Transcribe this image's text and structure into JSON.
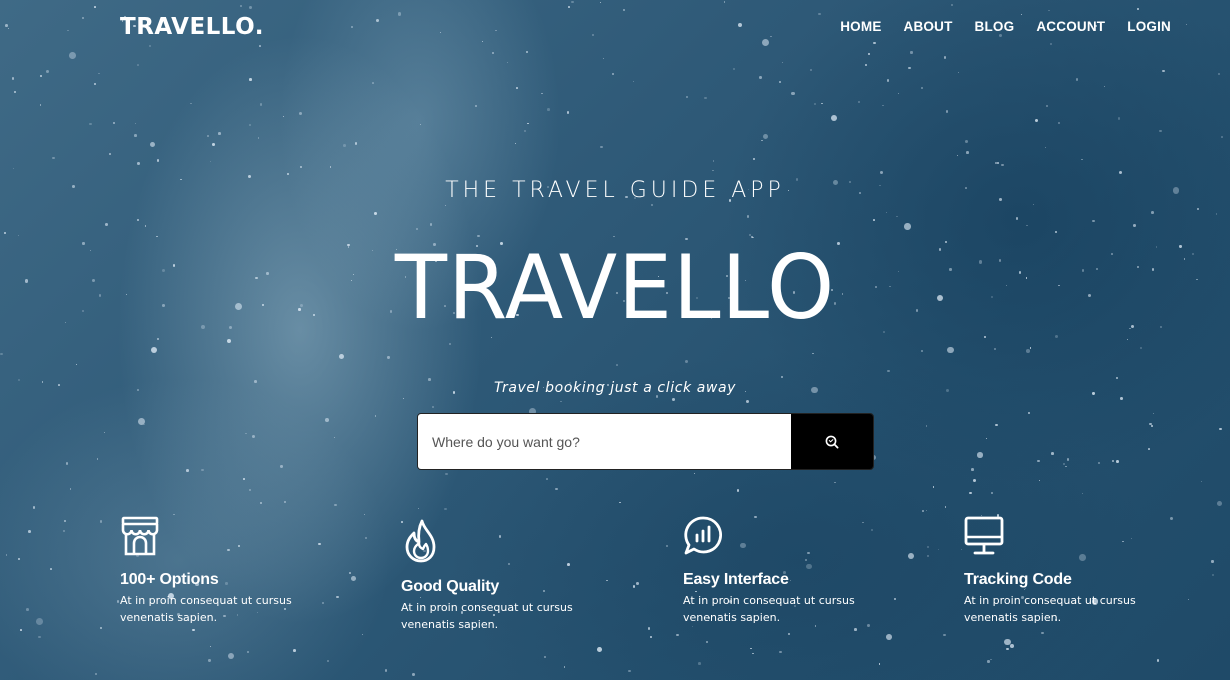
{
  "nav": {
    "logo": "TRAVELLO.",
    "items": [
      {
        "label": "HOME"
      },
      {
        "label": "ABOUT"
      },
      {
        "label": "BLOG"
      },
      {
        "label": "ACCOUNT"
      },
      {
        "label": "LOGIN"
      }
    ]
  },
  "hero": {
    "subtitle": "THE TRAVEL GUIDE APP",
    "title": "TRAVELLO",
    "tagline": "Travel booking just a click away"
  },
  "search": {
    "placeholder": "Where do you want go?",
    "button_icon": "search-icon"
  },
  "features": [
    {
      "icon": "store-icon",
      "title": "100+ Options",
      "text": "At in proin consequat ut cursus venenatis sapien."
    },
    {
      "icon": "flame-icon",
      "title": "Good Quality",
      "text": "At in proin consequat ut cursus venenatis sapien."
    },
    {
      "icon": "chat-chart-icon",
      "title": "Easy Interface",
      "text": "At in proin consequat ut cursus venenatis sapien."
    },
    {
      "icon": "monitor-icon",
      "title": "Tracking Code",
      "text": "At in proin consequat ut cursus venenatis sapien."
    }
  ],
  "colors": {
    "background": "#2c5470",
    "text": "#ffffff",
    "search_button": "#000000"
  }
}
